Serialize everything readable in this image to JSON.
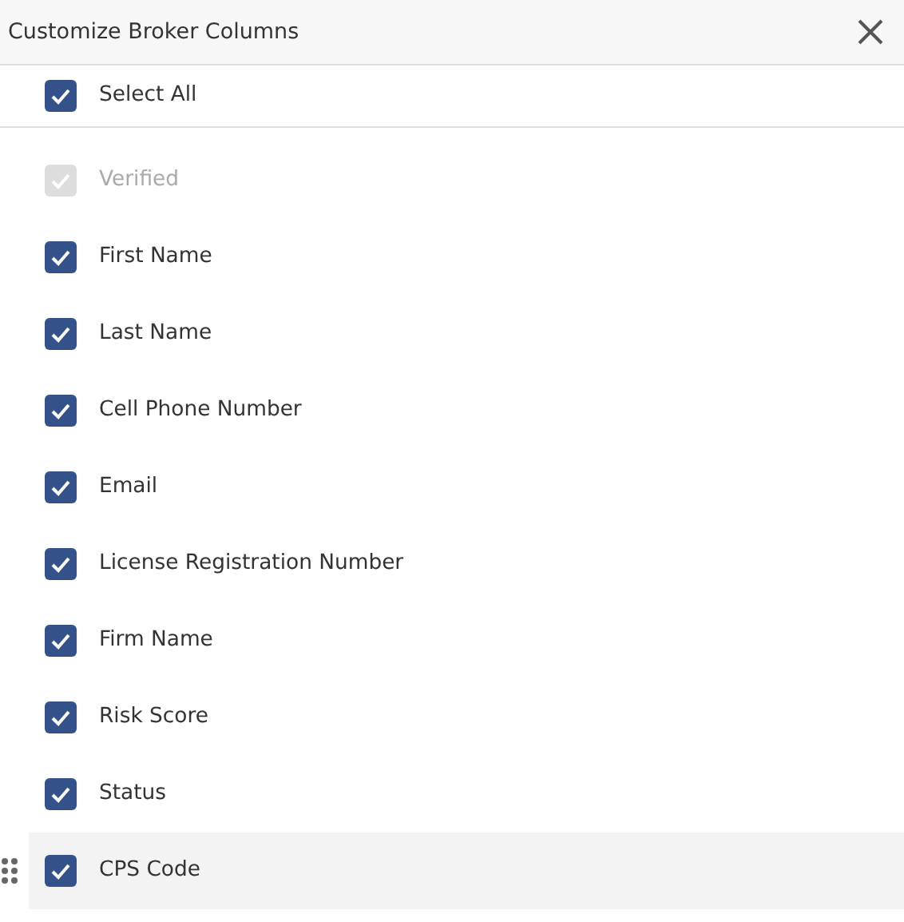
{
  "title": "Customize Broker Columns",
  "select_all": {
    "label": "Select All",
    "checked": true
  },
  "columns": [
    {
      "label": "Verified",
      "checked": true,
      "disabled": true,
      "hovered": false
    },
    {
      "label": "First Name",
      "checked": true,
      "disabled": false,
      "hovered": false
    },
    {
      "label": "Last Name",
      "checked": true,
      "disabled": false,
      "hovered": false
    },
    {
      "label": "Cell Phone Number",
      "checked": true,
      "disabled": false,
      "hovered": false
    },
    {
      "label": "Email",
      "checked": true,
      "disabled": false,
      "hovered": false
    },
    {
      "label": "License Registration Number",
      "checked": true,
      "disabled": false,
      "hovered": false
    },
    {
      "label": "Firm Name",
      "checked": true,
      "disabled": false,
      "hovered": false
    },
    {
      "label": "Risk Score",
      "checked": true,
      "disabled": false,
      "hovered": false
    },
    {
      "label": "Status",
      "checked": true,
      "disabled": false,
      "hovered": false
    },
    {
      "label": "CPS Code",
      "checked": true,
      "disabled": false,
      "hovered": true
    }
  ]
}
